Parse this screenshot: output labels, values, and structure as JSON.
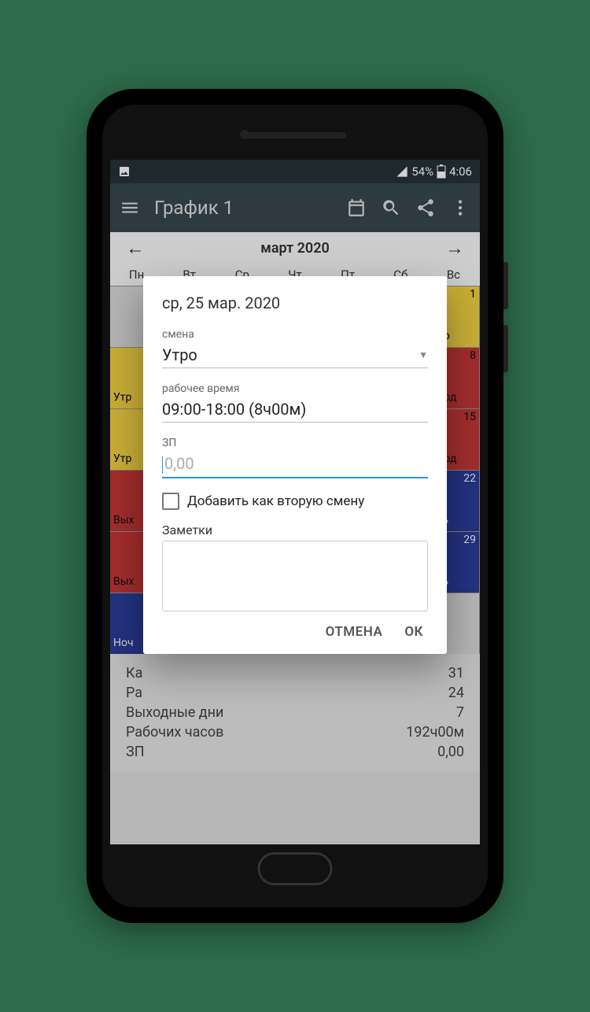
{
  "statusbar": {
    "battery_pct": "54%",
    "time": "4:06"
  },
  "toolbar": {
    "title": "График 1"
  },
  "month_nav": {
    "label": "март 2020"
  },
  "day_headers": [
    "Пн",
    "Вт",
    "Ср",
    "Чт",
    "Пт",
    "Сб",
    "Вс"
  ],
  "cal": {
    "row0": {
      "day7_num": "1",
      "day7_lbl": "'тро"
    },
    "row1": {
      "day1_lbl": "Утр",
      "day7_num": "8",
      "day7_lbl": "ыход"
    },
    "row2": {
      "day1_lbl": "Утр",
      "day7_num": "15",
      "day7_lbl": "ыход"
    },
    "row3": {
      "day1_lbl": "Вых",
      "day7_num": "22",
      "day7_lbl": "очь"
    },
    "row4": {
      "day1_lbl": "Вых",
      "day7_num": "29",
      "day7_lbl": "очь"
    },
    "row5": {
      "day1_lbl": "Ноч"
    }
  },
  "stats": {
    "r0_lbl": "Ка",
    "r0_val": "31",
    "r1_lbl": "Ра",
    "r1_val": "24",
    "r2_lbl": "Выходные дни",
    "r2_val": "7",
    "r3_lbl": "Рабочих часов",
    "r3_val": "192ч00м",
    "r4_lbl": "ЗП",
    "r4_val": "0,00"
  },
  "dialog": {
    "title": "ср, 25 мар. 2020",
    "shift_lbl": "смена",
    "shift_val": "Утро",
    "worktime_lbl": "рабочее время",
    "worktime_val": "09:00-18:00 (8ч00м)",
    "zp_lbl": "ЗП",
    "zp_placeholder": "0,00",
    "add_second_shift": "Добавить как вторую смену",
    "notes_lbl": "Заметки",
    "cancel": "ОТМЕНА",
    "ok": "ОК"
  }
}
